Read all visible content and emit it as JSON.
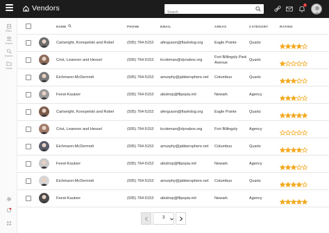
{
  "header": {
    "title": "Vendors",
    "search_placeholder": "Search"
  },
  "notifications_count": "1",
  "sidebar": {
    "items": [
      {
        "label": "Plans",
        "icon": "clipboard-icon"
      },
      {
        "label": "Teams",
        "icon": "users-icon"
      },
      {
        "label": "Search",
        "icon": "search-icon"
      },
      {
        "label": "Cases",
        "icon": "folder-icon"
      }
    ],
    "bottom_icons": [
      "gear-icon",
      "alert-icon",
      "grid-icon"
    ]
  },
  "table": {
    "columns": {
      "name": "NAME",
      "phone": "PHONE",
      "email": "EMAIL",
      "areas": "AREAS",
      "category": "CATEGORY",
      "rating": "RATING"
    },
    "rows": [
      {
        "name": "Cartwright, Konopelski and Robel",
        "phone": "(935) 764-5153",
        "email": "aferguson@flashdog.org",
        "areas": "Eagle Pointe",
        "category": "Quartz",
        "rating": 4
      },
      {
        "name": "Crist, Leannon and Hessel",
        "phone": "(935) 764-5153",
        "email": "kcoleman@dynabox.org",
        "areas": "Fort Billingsly Park Avenue",
        "category": "Quartz",
        "rating": 1
      },
      {
        "name": "Eichmann-McDermott",
        "phone": "(935) 764-5153",
        "email": "amurphy@jabbersphere.net",
        "areas": "Columbus",
        "category": "Quartz",
        "rating": 3
      },
      {
        "name": "Feest-Kautzer",
        "phone": "(935) 764-5153",
        "email": "abishop@flipopia.mil",
        "areas": "Newark",
        "category": "Agency",
        "rating": 3
      },
      {
        "name": "Cartwright, Konopelski and Robel",
        "phone": "(935) 764-5153",
        "email": "aferguson@flashdog.org",
        "areas": "Eagle Pointe",
        "category": "Quartz",
        "rating": 5
      },
      {
        "name": "Crist, Leannon and Hessel",
        "phone": "(935) 764-5153",
        "email": "kcoleman@dynabox.org",
        "areas": "Fort Billingsly",
        "category": "Agency",
        "rating": 0
      },
      {
        "name": "Eichmann-McDermott",
        "phone": "(935) 764-5153",
        "email": "amurphy@jabbersphere.net",
        "areas": "Columbus",
        "category": "Quartz",
        "rating": 4
      },
      {
        "name": "Feest-Kautzer",
        "phone": "(935) 764-5153",
        "email": "abishop@flipopia.mil",
        "areas": "Newark",
        "category": "Agency",
        "rating": 3
      },
      {
        "name": "Eichmann-McDermott",
        "phone": "(935) 764-5153",
        "email": "amurphy@jabbersphere.net",
        "areas": "Columbus",
        "category": "Quartz",
        "rating": 4
      },
      {
        "name": "Feest-Kautzer",
        "phone": "(935) 764-5153",
        "email": "abishop@flipopia.mil",
        "areas": "Newark",
        "category": "Agency",
        "rating": 5
      }
    ]
  },
  "pagination": {
    "current_page": "3"
  },
  "colors": {
    "topbar": "#1c1c1c",
    "star_filled": "#f2a81d",
    "star_empty": "#f2a81d",
    "notification": "#e02b2b"
  }
}
